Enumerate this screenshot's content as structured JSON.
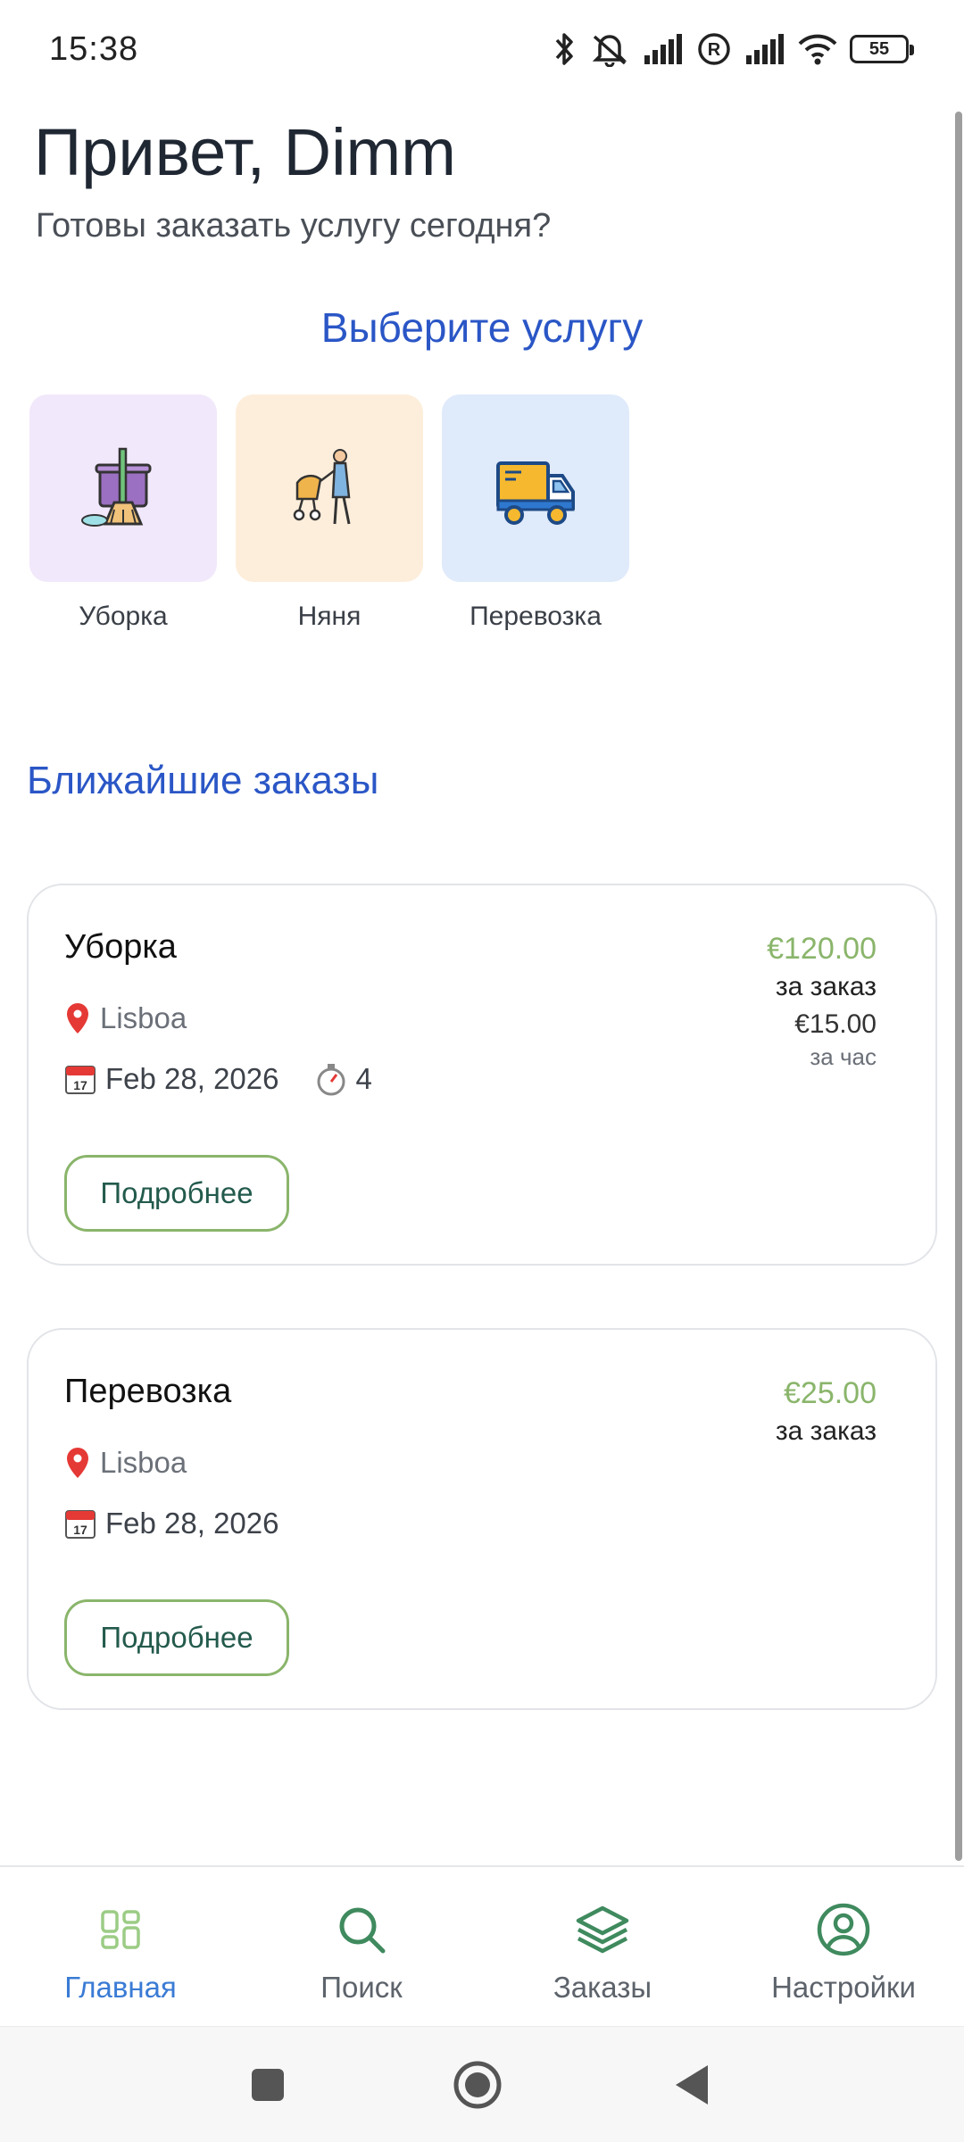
{
  "status_bar": {
    "time": "15:38",
    "battery": "55",
    "icons": [
      "bluetooth-icon",
      "bell-off-icon",
      "signal-icon",
      "registered-icon",
      "signal-icon",
      "wifi-icon",
      "battery-icon"
    ]
  },
  "home": {
    "greeting": "Привет, Dimm",
    "subtitle": "Готовы заказать услугу сегодня?",
    "services_title": "Выберите услугу",
    "services": [
      {
        "label": "Уборка",
        "icon": "cleaning-bucket-icon",
        "bg": "#f1e8fb"
      },
      {
        "label": "Няня",
        "icon": "nanny-stroller-icon",
        "bg": "#fdeedb"
      },
      {
        "label": "Перевозка",
        "icon": "delivery-truck-icon",
        "bg": "#dfeafb"
      }
    ],
    "orders_title": "Ближайшие заказы",
    "orders": [
      {
        "title": "Уборка",
        "location": "Lisboa",
        "date": "Feb 28, 2026",
        "hours": "4",
        "price": "€120.00",
        "price_label": "за заказ",
        "hourly_price": "€15.00",
        "hourly_label": "за час",
        "button": "Подробнее"
      },
      {
        "title": "Перевозка",
        "location": "Lisboa",
        "date": "Feb 28, 2026",
        "price": "€25.00",
        "price_label": "за заказ",
        "button": "Подробнее"
      }
    ]
  },
  "bottom_nav": {
    "items": [
      {
        "label": "Главная",
        "icon": "grid-icon",
        "active": true
      },
      {
        "label": "Поиск",
        "icon": "search-icon",
        "active": false
      },
      {
        "label": "Заказы",
        "icon": "layers-icon",
        "active": false
      },
      {
        "label": "Настройки",
        "icon": "user-circle-icon",
        "active": false
      }
    ]
  },
  "colors": {
    "accent_blue": "#2a56c6",
    "price_green": "#8ab56b",
    "active_nav": "#3a7bd5",
    "nav_icon_green": "#3f8a5e"
  }
}
